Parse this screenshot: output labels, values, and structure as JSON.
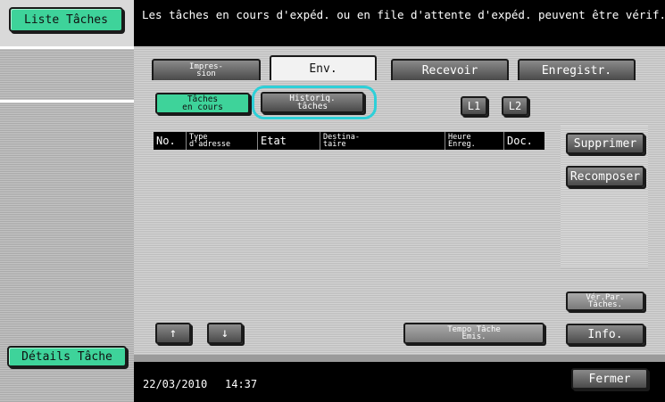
{
  "sidebar": {
    "top_button": "Liste Tâches",
    "bottom_button": "Détails Tâche"
  },
  "header": {
    "message": "Les tâches en cours d'expéd. ou en file d'attente d'expéd. peuvent être vérif."
  },
  "tabs": [
    {
      "label": "Impres-\nsion"
    },
    {
      "label": "Env."
    },
    {
      "label": "Recevoir"
    },
    {
      "label": "Enregistr."
    }
  ],
  "sub_buttons": {
    "current": "Tâches\nen cours",
    "history": "Historiq.\ntâches",
    "l1": "L1",
    "l2": "L2"
  },
  "table": {
    "columns": [
      "No.",
      "Type\nd'adresse",
      "Etat",
      "Destina-\ntaire",
      "Heure\nEnreg.",
      "Doc."
    ],
    "rows": []
  },
  "right_buttons": {
    "delete": "Supprimer",
    "recompose": "Recomposer",
    "check_settings": "Vér.Par.\nTâches.",
    "info": "Info.",
    "close": "Fermer"
  },
  "bottom_controls": {
    "up_icon": "↑",
    "down_icon": "↓",
    "send_timer": "Tempo Tâche\nEmis."
  },
  "footer": {
    "date": "22/03/2010",
    "time": "14:37"
  },
  "colors": {
    "accent_green": "#3ed39a",
    "highlight_cyan": "#2ed0d8",
    "header_bg": "#000000"
  }
}
